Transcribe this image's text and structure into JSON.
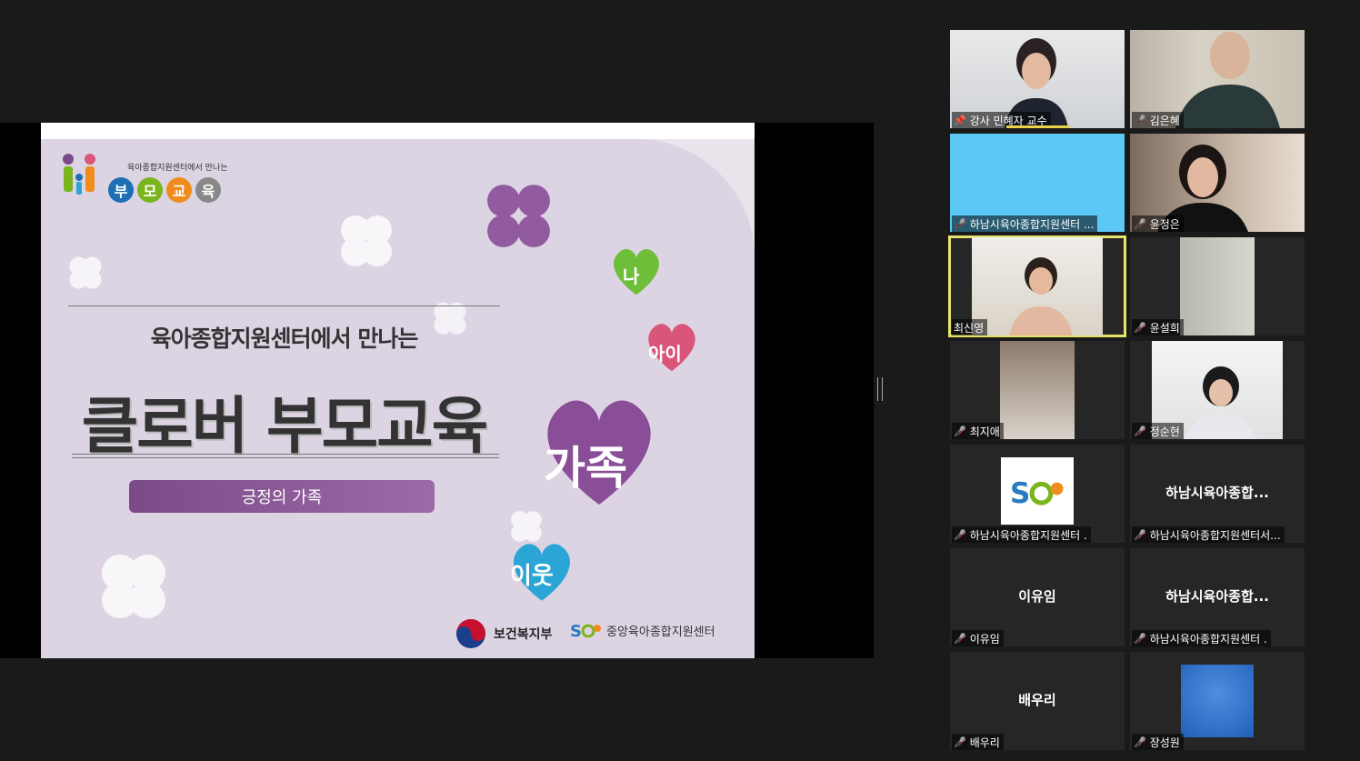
{
  "slide": {
    "brand_sub": "육아종합지원센터에서 만나는",
    "brand_chars": [
      {
        "text": "부",
        "color": "#1f6fb5"
      },
      {
        "text": "모",
        "color": "#7ab51d"
      },
      {
        "text": "교",
        "color": "#f08c1e"
      },
      {
        "text": "육",
        "color": "#888888"
      }
    ],
    "subtitle": "육아종합지원센터에서 만나는",
    "title": "클로버 부모교육",
    "pill": "긍정의 가족",
    "hearts": {
      "na": "나",
      "ai": "아이",
      "family": "가족",
      "neighbor": "이웃"
    },
    "footer_gov": "보건복지부",
    "footer_center": "중앙육아종합지원센터",
    "colors": {
      "purple": "#7b4a88",
      "green": "#6fbe3a",
      "pink": "#d9557a",
      "blue": "#2aa5d6"
    }
  },
  "participants": [
    {
      "label": "강사 민혜자 교수",
      "video": true,
      "pinned": true,
      "speaking": true
    },
    {
      "label": "김은혜",
      "video": true,
      "muted": true
    },
    {
      "label": "하남시육아종합지원센터 ...",
      "video": true,
      "muted": true
    },
    {
      "label": "윤정은",
      "video": true,
      "muted": true
    },
    {
      "label": "최신영",
      "video": true,
      "active": true
    },
    {
      "label": "윤설희",
      "video": true,
      "muted": true
    },
    {
      "label": "최지애",
      "video": true,
      "muted": true
    },
    {
      "label": "정순현",
      "video": true,
      "muted": true
    },
    {
      "label": "하남시육아종합지원센터 .",
      "video": true,
      "muted": true,
      "logo": true
    },
    {
      "label": "하남시육아종합지원센터서...",
      "bigname": "하남시육아종합...",
      "muted": true
    },
    {
      "label": "이유임",
      "bigname": "이유임",
      "muted": true
    },
    {
      "label": "하남시육아종합지원센터 .",
      "bigname": "하남시육아종합...",
      "muted": true
    },
    {
      "label": "배우리",
      "bigname": "배우리",
      "muted": true
    },
    {
      "label": "장성원",
      "video": true,
      "muted": true
    }
  ]
}
